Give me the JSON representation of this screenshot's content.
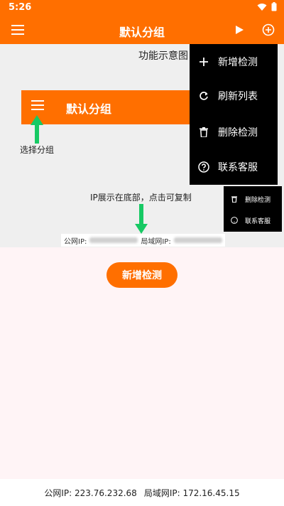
{
  "status": {
    "time": "5:26"
  },
  "appbar": {
    "title": "默认分组"
  },
  "guide": {
    "title": "功能示意图",
    "demo_title": "默认分组",
    "select_group": "选择分组",
    "ip_tip": "IP展示在底部，点击可复制",
    "public_ip_label": "公网IP:",
    "lan_ip_label": "局域网IP:"
  },
  "menu": {
    "items": [
      {
        "label": "新增检测",
        "icon": "plus-icon"
      },
      {
        "label": "刷新列表",
        "icon": "refresh-icon"
      },
      {
        "label": "删除检测",
        "icon": "trash-icon"
      },
      {
        "label": "联系客服",
        "icon": "help-icon"
      }
    ]
  },
  "mini_menu": {
    "items": [
      {
        "label": "删除检测",
        "icon": "trash-icon"
      },
      {
        "label": "联系客服",
        "icon": "help-icon"
      }
    ]
  },
  "main": {
    "add_button": "新增检测"
  },
  "footer": {
    "public_ip": "公网IP: 223.76.232.68",
    "lan_ip": "局域网IP: 172.16.45.15"
  },
  "colors": {
    "primary": "#ff6f00",
    "arrow": "#17c964",
    "menu_bg": "#000000",
    "content_bg": "#fff4f6"
  }
}
